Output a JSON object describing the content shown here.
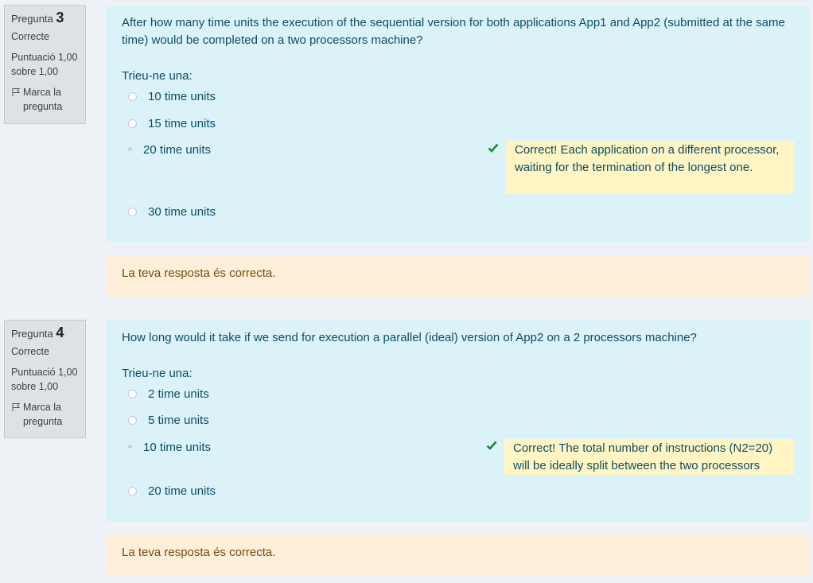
{
  "questions": [
    {
      "label": "Pregunta",
      "number": "3",
      "state": "Correcte",
      "grade_line1": "Puntuació 1,00",
      "grade_line2": "sobre 1,00",
      "flag_line1": "Marca la",
      "flag_line2": "pregunta",
      "text": "After how many time units the execution of the sequential version for both applications App1 and App2 (submitted at the same time) would be completed on a two processors machine?",
      "prompt": "Trieu-ne una:",
      "options": [
        {
          "label": "10 time units",
          "selected": false
        },
        {
          "label": "15 time units",
          "selected": false
        },
        {
          "label": "20 time units",
          "selected": true
        },
        {
          "label": "30 time units",
          "selected": false
        }
      ],
      "feedback": "Correct! Each application on a different processor, waiting for the termination of the longest one.",
      "outcome": "La teva resposta és correcta."
    },
    {
      "label": "Pregunta",
      "number": "4",
      "state": "Correcte",
      "grade_line1": "Puntuació 1,00",
      "grade_line2": "sobre 1,00",
      "flag_line1": "Marca la",
      "flag_line2": "pregunta",
      "text": "How long would it take if we send for execution a parallel (ideal) version of App2 on a 2 processors machine?",
      "prompt": "Trieu-ne una:",
      "options": [
        {
          "label": "2 time units",
          "selected": false
        },
        {
          "label": "5 time units",
          "selected": false
        },
        {
          "label": "10 time units",
          "selected": true
        },
        {
          "label": "20 time units",
          "selected": false
        }
      ],
      "feedback": "Correct! The total number of instructions (N2=20) will be ideally split between the two processors",
      "outcome": "La teva resposta és correcta."
    }
  ],
  "colors": {
    "check": "#1a8a3a",
    "feedback_bg": "#fff5c4",
    "content_bg": "#dbf2f9",
    "outcome_bg": "#fdefd9"
  }
}
